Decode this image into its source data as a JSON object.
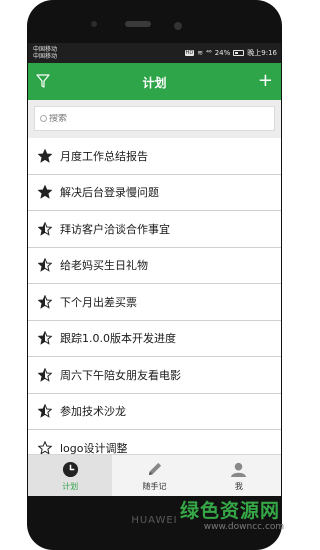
{
  "device": {
    "brand": "HUAWEI"
  },
  "status_bar": {
    "carrier_1": "中国移动",
    "carrier_2": "中国移动",
    "hd_badge": "HD",
    "signal": "⁴⁶",
    "battery": "24%",
    "time": "晚上9:16"
  },
  "header": {
    "title": "计划",
    "add_label": "+"
  },
  "search": {
    "placeholder": "搜索"
  },
  "plans": [
    {
      "text": "月度工作总结报告",
      "star": "full"
    },
    {
      "text": "解决后台登录慢问题",
      "star": "full"
    },
    {
      "text": "拜访客户洽谈合作事宜",
      "star": "half"
    },
    {
      "text": "给老妈买生日礼物",
      "star": "half"
    },
    {
      "text": "下个月出差买票",
      "star": "half"
    },
    {
      "text": "跟踪1.0.0版本开发进度",
      "star": "half"
    },
    {
      "text": "周六下午陪女朋友看电影",
      "star": "half"
    },
    {
      "text": "参加技术沙龙",
      "star": "half"
    },
    {
      "text": "logo设计调整",
      "star": "empty"
    }
  ],
  "tabs": [
    {
      "label": "计划",
      "icon": "clock-icon",
      "active": true
    },
    {
      "label": "随手记",
      "icon": "pen-icon",
      "active": false
    },
    {
      "label": "我",
      "icon": "user-icon",
      "active": false
    }
  ],
  "colors": {
    "accent": "#2fa54a",
    "statusbar": "#1f1f1f"
  },
  "watermark": {
    "name": "绿色资源网",
    "url": "www.downcc.com"
  }
}
